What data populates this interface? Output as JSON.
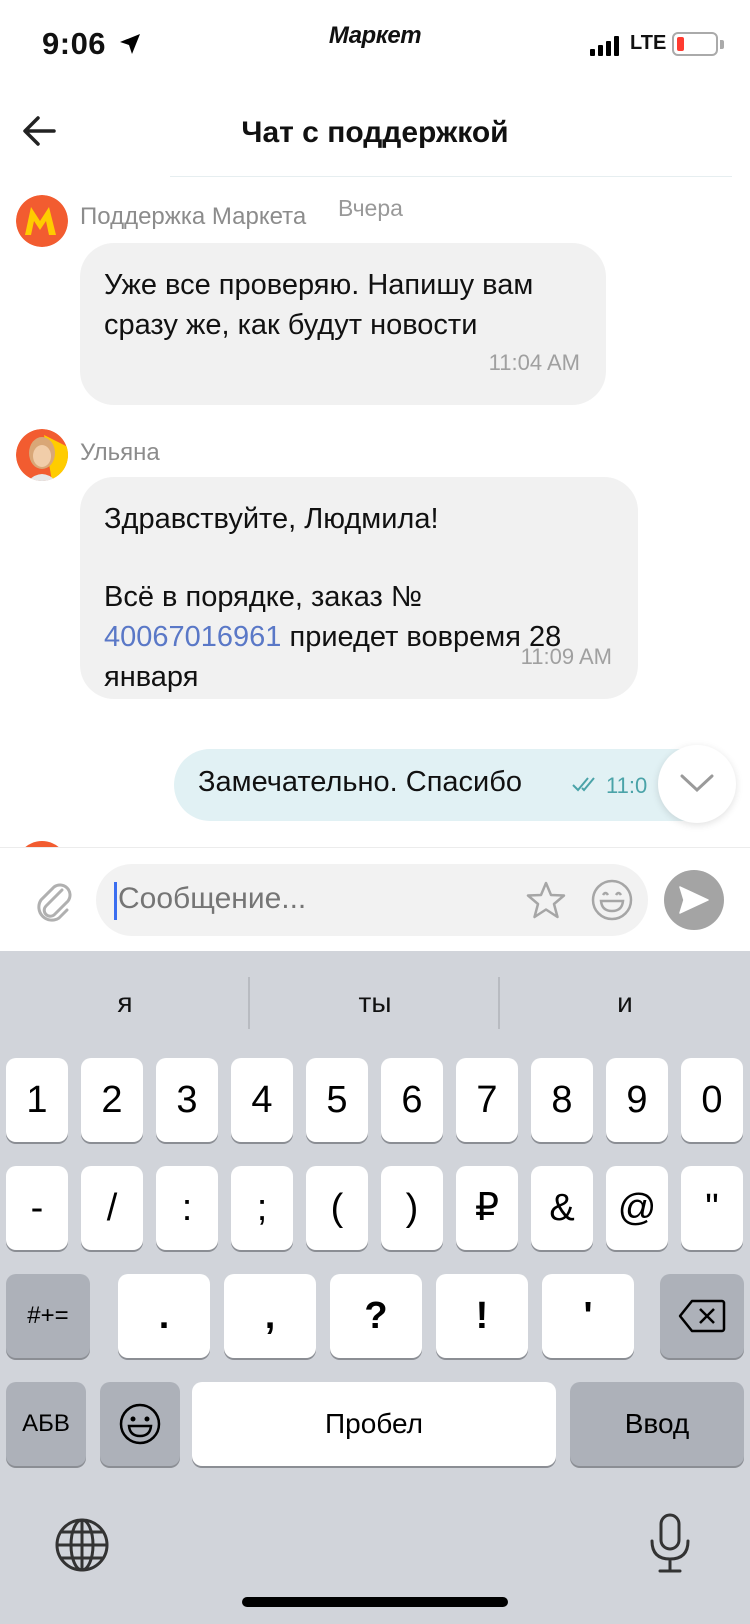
{
  "status_bar": {
    "time": "9:06",
    "app_logo": "Маркет",
    "network": "LTE"
  },
  "header": {
    "title": "Чат с поддержкой"
  },
  "chat": {
    "date_label": "Вчера",
    "messages": [
      {
        "sender": "Поддержка Маркета",
        "lines": [
          "Уже все проверяю. Напишу вам",
          "сразу же, как будут новости"
        ],
        "time": "11:04 AM"
      },
      {
        "sender": "Ульяна",
        "greeting": "Здравствуйте, Людмила!",
        "text_before": "Всё в порядке, заказ №",
        "order_link": "40067016961",
        "text_after_link": "приедет вовремя 28",
        "text_last": "января",
        "time": "11:09 AM"
      }
    ],
    "outgoing": {
      "text": "Замечательно. Спасибо",
      "time": "11:0"
    }
  },
  "composer": {
    "placeholder": "Сообщение..."
  },
  "keyboard": {
    "suggestions": [
      "я",
      "ты",
      "и"
    ],
    "row1": [
      "1",
      "2",
      "3",
      "4",
      "5",
      "6",
      "7",
      "8",
      "9",
      "0"
    ],
    "row2": [
      "-",
      "/",
      ":",
      ";",
      "(",
      ")",
      "₽",
      "&",
      "@",
      "\""
    ],
    "row3_left": "#+=",
    "row3": [
      ".",
      ",",
      "?",
      "!",
      "'"
    ],
    "abc": "АБВ",
    "space": "Пробел",
    "enter": "Ввод"
  },
  "colors": {
    "brand_yellow": "#ffcc00",
    "brand_red": "#f25c30",
    "incoming_bubble": "#f1f1f1",
    "outgoing_bubble": "#e1f1f4",
    "link": "#5a78c7",
    "read_check": "#4aa3a8"
  }
}
